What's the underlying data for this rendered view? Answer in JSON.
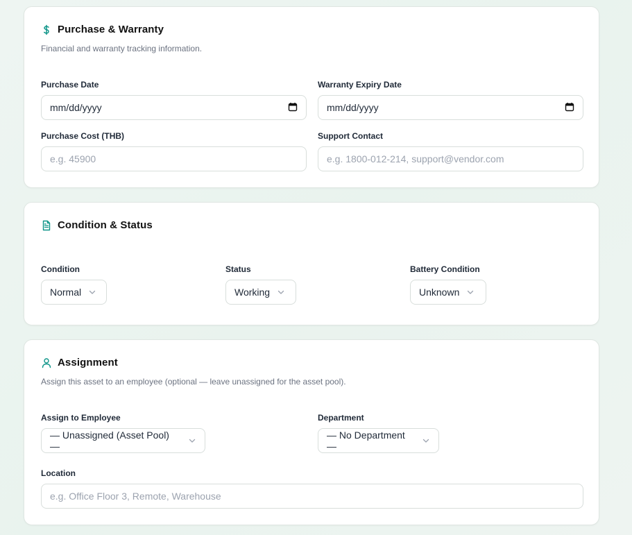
{
  "purchase": {
    "title": "Purchase & Warranty",
    "description": "Financial and warranty tracking information.",
    "purchase_date_label": "Purchase Date",
    "purchase_date_value": "mm/dd/yyyy",
    "warranty_label": "Warranty Expiry Date",
    "warranty_value": "mm/dd/yyyy",
    "cost_label": "Purchase Cost (THB)",
    "cost_placeholder": "e.g. 45900",
    "support_label": "Support Contact",
    "support_placeholder": "e.g. 1800-012-214, support@vendor.com"
  },
  "condition": {
    "title": "Condition & Status",
    "condition_label": "Condition",
    "condition_value": "Normal",
    "status_label": "Status",
    "status_value": "Working",
    "battery_label": "Battery Condition",
    "battery_value": "Unknown"
  },
  "assignment": {
    "title": "Assignment",
    "description": "Assign this asset to an employee (optional — leave unassigned for the asset pool).",
    "employee_label": "Assign to Employee",
    "employee_value": "— Unassigned (Asset Pool) —",
    "department_label": "Department",
    "department_value": "— No Department —",
    "location_label": "Location",
    "location_placeholder": "e.g. Office Floor 3, Remote, Warehouse"
  },
  "icons": {
    "purchase": "dollar-icon",
    "condition": "document-icon",
    "assignment": "user-icon",
    "calendar": "calendar-icon",
    "chevron": "chevron-down-icon"
  },
  "colors": {
    "accent": "#0d9488"
  }
}
